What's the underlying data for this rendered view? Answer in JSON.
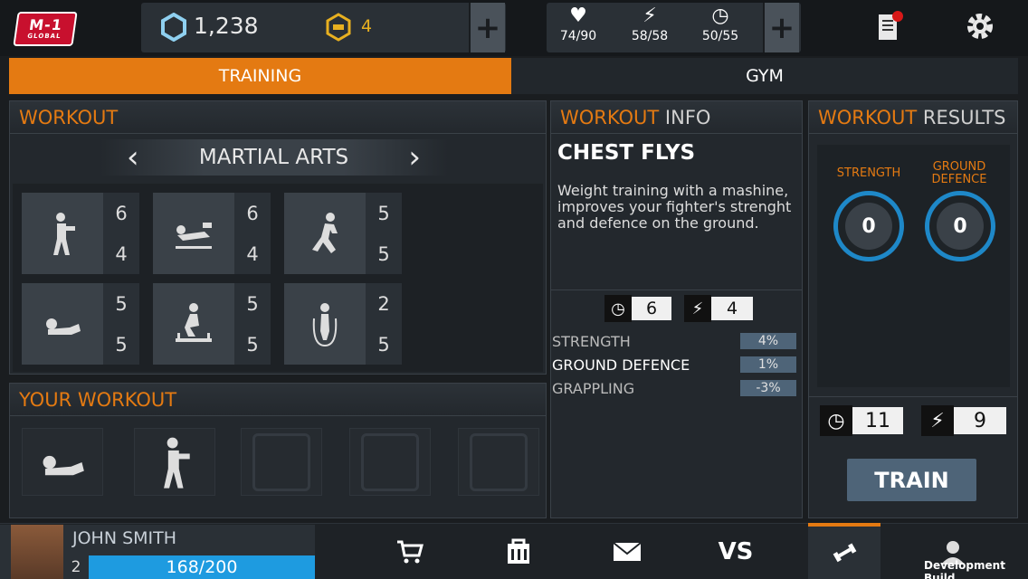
{
  "topbar": {
    "logo_text": "M-1",
    "logo_sub": "GLOBAL",
    "coins": "1,238",
    "gold": "4",
    "health": "74/90",
    "energy": "58/58",
    "time": "50/55",
    "plus_label": "+"
  },
  "tabs": [
    "TRAINING",
    "GYM"
  ],
  "workout": {
    "title": "WORKOUT",
    "category": "MARTIAL ARTS",
    "prev": "‹",
    "next": "›",
    "tiles": [
      {
        "icon": "boxer-icon",
        "a": "6",
        "b": "4"
      },
      {
        "icon": "chest-fly-icon",
        "a": "6",
        "b": "4"
      },
      {
        "icon": "runner-icon",
        "a": "5",
        "b": "5"
      },
      {
        "icon": "situp-icon",
        "a": "5",
        "b": "5"
      },
      {
        "icon": "squat-icon",
        "a": "5",
        "b": "5"
      },
      {
        "icon": "jump-rope-icon",
        "a": "2",
        "b": "5"
      }
    ]
  },
  "your_workout": {
    "title": "YOUR WORKOUT"
  },
  "info": {
    "title_a": "WORKOUT",
    "title_b": " INFO",
    "name": "CHEST FLYS",
    "desc": "Weight training with a mashine, improves your fighter's strenght and defence on the ground.",
    "time": "6",
    "energy": "4",
    "stats": [
      {
        "label": "STRENGTH",
        "value": "4%"
      },
      {
        "label": "GROUND DEFENCE",
        "value": "1%"
      },
      {
        "label": "GRAPPLING",
        "value": "-3%"
      }
    ]
  },
  "results": {
    "title_a": "WORKOUT",
    "title_b": " RESULTS",
    "strength_label": "STRENGTH",
    "ground_label_1": "GROUND",
    "ground_label_2": "DEFENCE",
    "strength_value": "0",
    "ground_value": "0",
    "time": "11",
    "energy": "9",
    "train_label": "TRAIN"
  },
  "player": {
    "name": "JOHN SMITH",
    "level": "2",
    "xp": "168/200"
  },
  "bottom_nav": [
    "cart-icon",
    "store-icon",
    "mail-icon",
    "versus-icon",
    "dumbbell-icon",
    "profile-icon"
  ],
  "versus_text": "VS",
  "dev_label": "Development Build",
  "colors": {
    "accent": "#e47a12",
    "blue": "#1e9be0"
  }
}
